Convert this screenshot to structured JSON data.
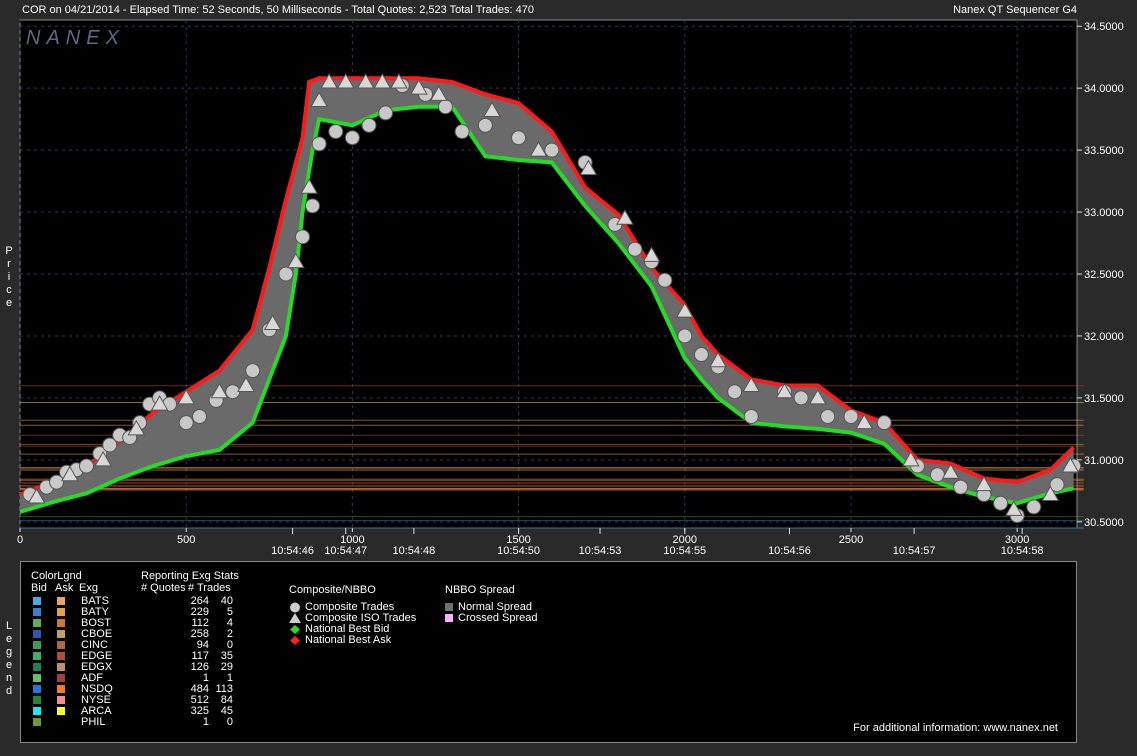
{
  "header": {
    "info": "COR on 04/21/2014  -  Elapsed Time: 52 Seconds, 50 Milliseconds  -  Total Quotes: 2,523  Total Trades: 470",
    "app": "Nanex QT Sequencer G4"
  },
  "watermark": "NANEX",
  "side_labels": {
    "price": "Price",
    "legend": "Legend"
  },
  "chart_data": {
    "type": "line",
    "y_ticks": [
      "34.5000",
      "34.0000",
      "33.5000",
      "33.0000",
      "32.5000",
      "32.0000",
      "31.5000",
      "31.0000",
      "30.5000"
    ],
    "y_values": [
      34.5,
      34.0,
      33.5,
      33.0,
      32.5,
      32.0,
      31.5,
      31.0,
      30.5
    ],
    "ylim": [
      30.45,
      34.55
    ],
    "x_ticks": [
      "0",
      "500",
      "1000",
      "1500",
      "2000",
      "2500",
      "3000"
    ],
    "x_tick_values": [
      0,
      500,
      1000,
      1500,
      2000,
      2500,
      3000
    ],
    "xlim": [
      0,
      3180
    ],
    "time_labels": [
      {
        "x": 820,
        "label": "10:54:46"
      },
      {
        "x": 980,
        "label": "10:54:47"
      },
      {
        "x": 1185,
        "label": "10:54:48"
      },
      {
        "x": 1500,
        "label": "10:54:50"
      },
      {
        "x": 1745,
        "label": "10:54:53"
      },
      {
        "x": 2000,
        "label": "10:54:55"
      },
      {
        "x": 2315,
        "label": "10:54:56"
      },
      {
        "x": 2690,
        "label": "10:54:57"
      },
      {
        "x": 3015,
        "label": "10:54:58"
      }
    ],
    "series": [
      {
        "name": "National Best Ask",
        "color": "#ff1a1a",
        "points": [
          [
            0,
            30.72
          ],
          [
            100,
            30.82
          ],
          [
            200,
            30.95
          ],
          [
            300,
            31.15
          ],
          [
            400,
            31.38
          ],
          [
            500,
            31.55
          ],
          [
            600,
            31.72
          ],
          [
            700,
            32.05
          ],
          [
            750,
            32.55
          ],
          [
            800,
            33.1
          ],
          [
            850,
            33.6
          ],
          [
            870,
            34.05
          ],
          [
            900,
            34.08
          ],
          [
            1000,
            34.08
          ],
          [
            1100,
            34.08
          ],
          [
            1200,
            34.08
          ],
          [
            1300,
            34.05
          ],
          [
            1400,
            33.95
          ],
          [
            1500,
            33.88
          ],
          [
            1600,
            33.65
          ],
          [
            1700,
            33.2
          ],
          [
            1800,
            32.98
          ],
          [
            1900,
            32.55
          ],
          [
            2000,
            32.25
          ],
          [
            2050,
            32.0
          ],
          [
            2100,
            31.85
          ],
          [
            2200,
            31.65
          ],
          [
            2300,
            31.6
          ],
          [
            2400,
            31.6
          ],
          [
            2500,
            31.4
          ],
          [
            2600,
            31.3
          ],
          [
            2700,
            31.0
          ],
          [
            2800,
            30.97
          ],
          [
            2900,
            30.85
          ],
          [
            3000,
            30.82
          ],
          [
            3100,
            30.92
          ],
          [
            3170,
            31.1
          ]
        ]
      },
      {
        "name": "National Best Bid",
        "color": "#22dd22",
        "points": [
          [
            0,
            30.58
          ],
          [
            100,
            30.66
          ],
          [
            200,
            30.73
          ],
          [
            300,
            30.85
          ],
          [
            400,
            30.95
          ],
          [
            500,
            31.03
          ],
          [
            600,
            31.08
          ],
          [
            700,
            31.3
          ],
          [
            750,
            31.65
          ],
          [
            800,
            32.0
          ],
          [
            830,
            32.5
          ],
          [
            850,
            33.0
          ],
          [
            880,
            33.5
          ],
          [
            900,
            33.75
          ],
          [
            1000,
            33.7
          ],
          [
            1100,
            33.82
          ],
          [
            1200,
            33.85
          ],
          [
            1300,
            33.85
          ],
          [
            1400,
            33.45
          ],
          [
            1500,
            33.42
          ],
          [
            1600,
            33.4
          ],
          [
            1700,
            33.05
          ],
          [
            1800,
            32.75
          ],
          [
            1900,
            32.4
          ],
          [
            2000,
            31.82
          ],
          [
            2050,
            31.65
          ],
          [
            2100,
            31.5
          ],
          [
            2200,
            31.3
          ],
          [
            2300,
            31.27
          ],
          [
            2400,
            31.25
          ],
          [
            2500,
            31.22
          ],
          [
            2600,
            31.13
          ],
          [
            2700,
            30.88
          ],
          [
            2800,
            30.78
          ],
          [
            2900,
            30.7
          ],
          [
            3000,
            30.65
          ],
          [
            3100,
            30.73
          ],
          [
            3170,
            30.77
          ]
        ]
      }
    ],
    "trades": {
      "name": "Composite Trades",
      "points": [
        [
          30,
          30.72
        ],
        [
          80,
          30.78
        ],
        [
          110,
          30.82
        ],
        [
          140,
          30.9
        ],
        [
          170,
          30.92
        ],
        [
          200,
          30.95
        ],
        [
          240,
          31.05
        ],
        [
          270,
          31.12
        ],
        [
          300,
          31.2
        ],
        [
          330,
          31.18
        ],
        [
          360,
          31.3
        ],
        [
          390,
          31.45
        ],
        [
          420,
          31.5
        ],
        [
          450,
          31.45
        ],
        [
          500,
          31.3
        ],
        [
          540,
          31.35
        ],
        [
          590,
          31.48
        ],
        [
          640,
          31.55
        ],
        [
          700,
          31.72
        ],
        [
          750,
          32.05
        ],
        [
          800,
          32.5
        ],
        [
          850,
          32.8
        ],
        [
          880,
          33.05
        ],
        [
          900,
          33.55
        ],
        [
          950,
          33.65
        ],
        [
          1000,
          33.6
        ],
        [
          1050,
          33.7
        ],
        [
          1100,
          33.8
        ],
        [
          1150,
          34.02
        ],
        [
          1220,
          33.95
        ],
        [
          1280,
          33.85
        ],
        [
          1330,
          33.65
        ],
        [
          1400,
          33.7
        ],
        [
          1500,
          33.6
        ],
        [
          1600,
          33.5
        ],
        [
          1700,
          33.4
        ],
        [
          1790,
          32.9
        ],
        [
          1850,
          32.7
        ],
        [
          1900,
          32.6
        ],
        [
          1940,
          32.45
        ],
        [
          2000,
          32.0
        ],
        [
          2050,
          31.85
        ],
        [
          2100,
          31.75
        ],
        [
          2150,
          31.55
        ],
        [
          2200,
          31.35
        ],
        [
          2300,
          31.55
        ],
        [
          2350,
          31.5
        ],
        [
          2430,
          31.35
        ],
        [
          2500,
          31.35
        ],
        [
          2600,
          31.3
        ],
        [
          2700,
          30.95
        ],
        [
          2760,
          30.88
        ],
        [
          2830,
          30.78
        ],
        [
          2900,
          30.72
        ],
        [
          2950,
          30.65
        ],
        [
          3000,
          30.55
        ],
        [
          3050,
          30.62
        ],
        [
          3120,
          30.8
        ],
        [
          3170,
          30.95
        ]
      ]
    },
    "iso_trades": {
      "name": "Composite ISO Trades",
      "points": [
        [
          50,
          30.7
        ],
        [
          150,
          30.88
        ],
        [
          250,
          31.0
        ],
        [
          350,
          31.25
        ],
        [
          420,
          31.45
        ],
        [
          500,
          31.5
        ],
        [
          600,
          31.55
        ],
        [
          680,
          31.6
        ],
        [
          760,
          32.1
        ],
        [
          830,
          32.6
        ],
        [
          870,
          33.2
        ],
        [
          900,
          33.9
        ],
        [
          930,
          34.05
        ],
        [
          980,
          34.05
        ],
        [
          1040,
          34.05
        ],
        [
          1090,
          34.05
        ],
        [
          1140,
          34.05
        ],
        [
          1200,
          34.0
        ],
        [
          1260,
          33.95
        ],
        [
          1420,
          33.82
        ],
        [
          1560,
          33.5
        ],
        [
          1710,
          33.35
        ],
        [
          1820,
          32.95
        ],
        [
          1900,
          32.65
        ],
        [
          2000,
          32.2
        ],
        [
          2100,
          31.8
        ],
        [
          2200,
          31.6
        ],
        [
          2300,
          31.55
        ],
        [
          2400,
          31.5
        ],
        [
          2540,
          31.3
        ],
        [
          2680,
          31.0
        ],
        [
          2800,
          30.9
        ],
        [
          2900,
          30.8
        ],
        [
          2990,
          30.6
        ],
        [
          3100,
          30.72
        ],
        [
          3160,
          30.95
        ]
      ]
    },
    "legend": {
      "header_colorlgnd": "ColorLgnd",
      "header_bid": "Bid",
      "header_ask": "Ask",
      "header_exg": "Exg",
      "header_stats": "Reporting Exg Stats",
      "header_quotes": "# Quotes",
      "header_trades": "# Trades",
      "header_composite": "Composite/NBBO",
      "header_spread": "NBBO Spread",
      "exchanges": [
        {
          "name": "BATS",
          "quotes": "264",
          "trades": "40",
          "bid": "#4aa8e8",
          "ask": "#f0a060"
        },
        {
          "name": "BATY",
          "quotes": "229",
          "trades": "5",
          "bid": "#3a7fd0",
          "ask": "#e8a040"
        },
        {
          "name": "BOST",
          "quotes": "112",
          "trades": "4",
          "bid": "#5ab05a",
          "ask": "#d07830"
        },
        {
          "name": "CBOE",
          "quotes": "258",
          "trades": "2",
          "bid": "#2e55b0",
          "ask": "#c0a060"
        },
        {
          "name": "CINC",
          "quotes": "94",
          "trades": "0",
          "bid": "#3aa050",
          "ask": "#b06840"
        },
        {
          "name": "EDGE",
          "quotes": "117",
          "trades": "35",
          "bid": "#40b060",
          "ask": "#b05030"
        },
        {
          "name": "EDGX",
          "quotes": "126",
          "trades": "29",
          "bid": "#208050",
          "ask": "#c09070"
        },
        {
          "name": "ADF",
          "quotes": "1",
          "trades": "1",
          "bid": "#60c070",
          "ask": "#a04040"
        },
        {
          "name": "NSDQ",
          "quotes": "484",
          "trades": "113",
          "bid": "#1e78e0",
          "ask": "#f08010"
        },
        {
          "name": "NYSE",
          "quotes": "512",
          "trades": "84",
          "bid": "#208830",
          "ask": "#f09090"
        },
        {
          "name": "ARCA",
          "quotes": "325",
          "trades": "45",
          "bid": "#18e8f0",
          "ask": "#ffff20"
        },
        {
          "name": "PHIL",
          "quotes": "1",
          "trades": "0",
          "bid": "#6a9a3a",
          "ask": ""
        }
      ],
      "composite_items": [
        {
          "label": "Composite Trades",
          "icon": "circle",
          "color": "#cccccc"
        },
        {
          "label": "Composite ISO Trades",
          "icon": "triangle",
          "color": "#cccccc"
        },
        {
          "label": "National Best Bid",
          "icon": "diamond",
          "color": "#22dd22"
        },
        {
          "label": "National Best Ask",
          "icon": "diamond",
          "color": "#ff2020"
        }
      ],
      "spread_items": [
        {
          "label": "Normal Spread",
          "color": "#707070"
        },
        {
          "label": "Crossed Spread",
          "color": "#ffb0ff"
        }
      ],
      "footer": "For additional information: www.nanex.net"
    }
  }
}
